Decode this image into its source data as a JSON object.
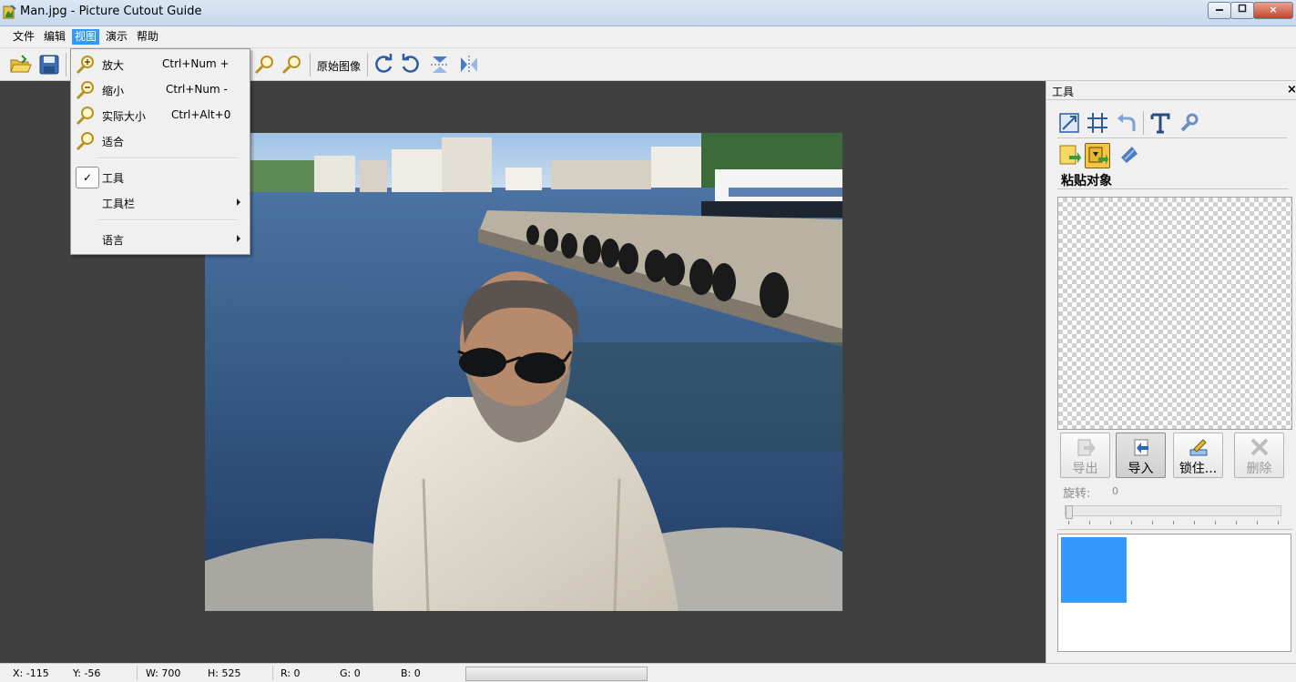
{
  "window": {
    "title": "Man.jpg - Picture Cutout Guide",
    "min_icon": "minimize-icon",
    "max_icon": "maximize-icon",
    "close_label": "×"
  },
  "menubar": {
    "items": [
      {
        "label": "文件",
        "active": false
      },
      {
        "label": "编辑",
        "active": false
      },
      {
        "label": "视图",
        "active": true
      },
      {
        "label": "演示",
        "active": false
      },
      {
        "label": "帮助",
        "active": false
      }
    ]
  },
  "toolbar": {
    "original_image_label": "原始图像",
    "icons": [
      "open-folder-icon",
      "save-icon",
      "zoom-in-icon",
      "zoom-out-icon",
      "rotate-clockwise-icon",
      "rotate-counterclockwise-icon",
      "flip-vertical-icon",
      "flip-horizontal-icon"
    ]
  },
  "view_menu": {
    "items": [
      {
        "label": "放大",
        "shortcut": "Ctrl+Num +",
        "icon": "zoom-in-icon"
      },
      {
        "label": "缩小",
        "shortcut": "Ctrl+Num -",
        "icon": "zoom-out-icon"
      },
      {
        "label": "实际大小",
        "shortcut": "Ctrl+Alt+0",
        "icon": "actual-size-icon"
      },
      {
        "label": "适合",
        "shortcut": "",
        "icon": "fit-icon"
      }
    ],
    "tools": {
      "label": "工具",
      "check": "✓",
      "checked": true
    },
    "toolbars": {
      "label": "工具栏"
    },
    "language": {
      "label": "语言"
    }
  },
  "panel": {
    "title": "工具",
    "close": "×",
    "section_label": "粘贴对象",
    "buttons": [
      {
        "label": "导出",
        "enabled": false,
        "icon": "export-icon"
      },
      {
        "label": "导入",
        "enabled": true,
        "icon": "import-icon"
      },
      {
        "label": "锁住...",
        "enabled": true,
        "icon": "lock-edit-icon"
      },
      {
        "label": "删除",
        "enabled": false,
        "icon": "delete-icon"
      }
    ],
    "rotate_label": "旋转:",
    "rotate_value": "0",
    "swatch_color": "#3399ff"
  },
  "statusbar": {
    "x": "X: -115",
    "y": "Y: -56",
    "w": "W: 700",
    "h": "H: 525",
    "r": "R: 0",
    "g": "G: 0",
    "b": "B: 0"
  },
  "photo": {
    "description_icon": "photo-man-sunglasses-harbor"
  }
}
